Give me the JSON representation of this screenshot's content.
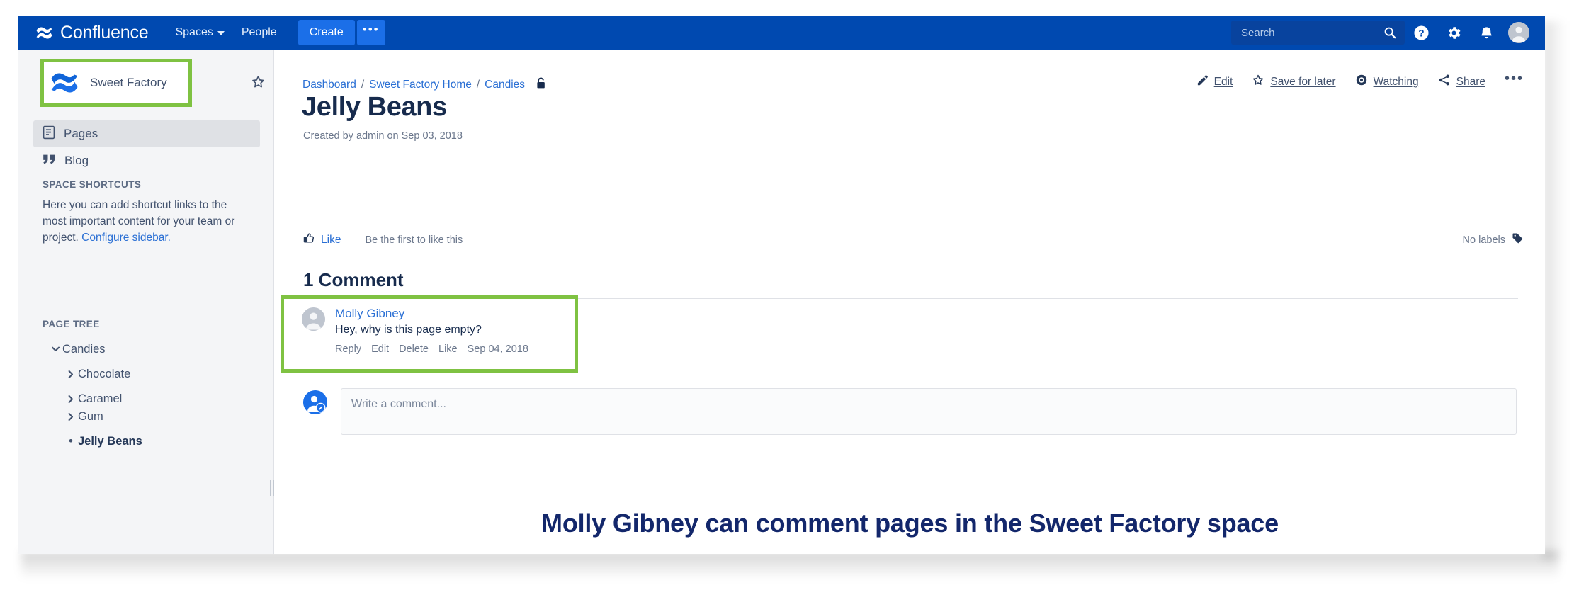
{
  "topnav": {
    "brand": "Confluence",
    "brand_logo_icon": "confluence-logo-icon",
    "items": [
      {
        "label": "Spaces",
        "icon": "chevron-down-icon"
      },
      {
        "label": "People",
        "icon": ""
      }
    ],
    "create_label": "Create",
    "more_label": "•••",
    "search": {
      "placeholder": "Search",
      "value": "",
      "icon": "search-icon"
    },
    "icons": [
      {
        "name": "help-icon",
        "glyph": "?"
      },
      {
        "name": "gear-icon",
        "glyph": "⚙"
      },
      {
        "name": "notification-bell-icon",
        "glyph": "🔔"
      }
    ],
    "avatar_icon": "user-avatar-icon"
  },
  "sidebar": {
    "space": {
      "name": "Sweet Factory",
      "avatar_icon": "confluence-space-avatar-icon"
    },
    "star_icon": "star-outline-icon",
    "links": [
      {
        "label": "Pages",
        "icon": "page-document-icon",
        "selected": true
      },
      {
        "label": "Blog",
        "icon": "quote-icon",
        "selected": false
      }
    ],
    "shortcuts": {
      "heading": "SPACE SHORTCUTS",
      "text": "Here you can add shortcut links to the most important content for your team or project. ",
      "link": "Configure sidebar."
    },
    "pagetree": {
      "heading": "PAGE TREE",
      "nodes": [
        {
          "label": "Candies",
          "toggle": "chevron-down-icon",
          "current": false
        },
        {
          "label": "Chocolate",
          "toggle": "chevron-right-icon",
          "current": false
        },
        {
          "label": "Caramel",
          "toggle": "chevron-right-icon",
          "current": false
        },
        {
          "label": "Gum",
          "toggle": "chevron-right-icon",
          "current": false
        },
        {
          "label": "Jelly Beans",
          "toggle": "bullet-dot",
          "current": true
        }
      ]
    },
    "resize_handle_icon": "resize-grip-icon"
  },
  "main": {
    "breadcrumb": [
      {
        "label": "Dashboard"
      },
      {
        "label": "Sweet Factory Home"
      },
      {
        "label": "Candies"
      }
    ],
    "breadcrumb_separator": "/",
    "restriction_icon": "unlocked-padlock-icon",
    "title": "Jelly Beans",
    "meta": "Created by admin on Sep 03, 2018",
    "actions": [
      {
        "label": "Edit",
        "icon": "pencil-icon"
      },
      {
        "label": "Save for later",
        "icon": "star-outline-icon"
      },
      {
        "label": "Watching",
        "icon": "eye-icon"
      },
      {
        "label": "Share",
        "icon": "share-icon"
      }
    ],
    "more_actions_label": "•••",
    "like": {
      "label": "Like",
      "icon": "thumbs-up-icon",
      "hint": "Be the first to like this"
    },
    "labels": {
      "text": "No labels",
      "icon": "tag-icon"
    },
    "comments_heading": "1 Comment",
    "comment": {
      "author": "Molly Gibney",
      "avatar_icon": "user-avatar-icon",
      "text": "Hey, why is this page empty?",
      "actions": [
        "Reply",
        "Edit",
        "Delete",
        "Like"
      ],
      "date": "Sep 04, 2018"
    },
    "composer": {
      "avatar_icon": "user-edit-avatar-icon",
      "placeholder": "Write a comment...",
      "value": ""
    }
  },
  "caption": "Molly Gibney can comment pages in the Sweet Factory space",
  "colors": {
    "nav_blue": "#0049B0",
    "create_blue": "#1B6FE8",
    "highlight_green": "#7FC242",
    "link_blue": "#2A6FD4",
    "caption_navy": "#13276B",
    "sidebar_bg": "#F4F5F7"
  }
}
